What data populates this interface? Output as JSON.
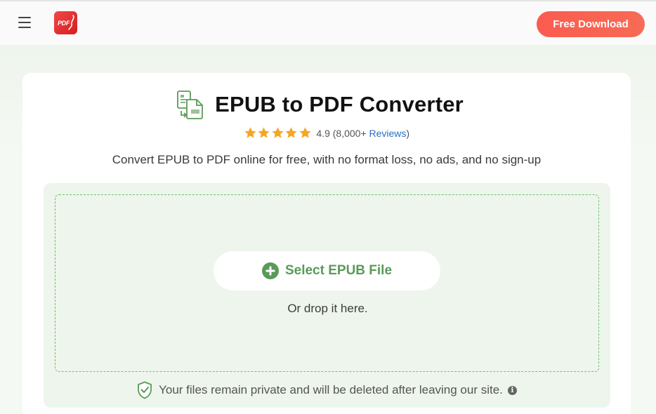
{
  "header": {
    "logo_text": "PDF",
    "download_label": "Free Download"
  },
  "hero": {
    "title": "EPUB to PDF Converter",
    "rating_value": "4.9",
    "rating_count": "(8,000+",
    "reviews_label": "Reviews",
    "rating_close": ")",
    "stars": 5,
    "subtitle": "Convert EPUB to PDF online for free, with no format loss, no ads, and no sign-up"
  },
  "upload": {
    "button_label": "Select EPUB File",
    "drop_hint": "Or drop it here.",
    "privacy_note": "Your files remain private and will be deleted after leaving our site."
  },
  "icons": {
    "menu": "hamburger-icon",
    "logo": "pdf-logo-icon",
    "converter": "epub-to-pdf-icon",
    "star": "star-icon",
    "add": "plus-circle-icon",
    "shield": "shield-check-icon",
    "info": "info-icon"
  },
  "colors": {
    "accent_green": "#5a9a58",
    "download_button": "#fb5b4f",
    "star": "#f5a623",
    "link": "#2a6fc6",
    "panel_bg": "#eef5ec"
  }
}
